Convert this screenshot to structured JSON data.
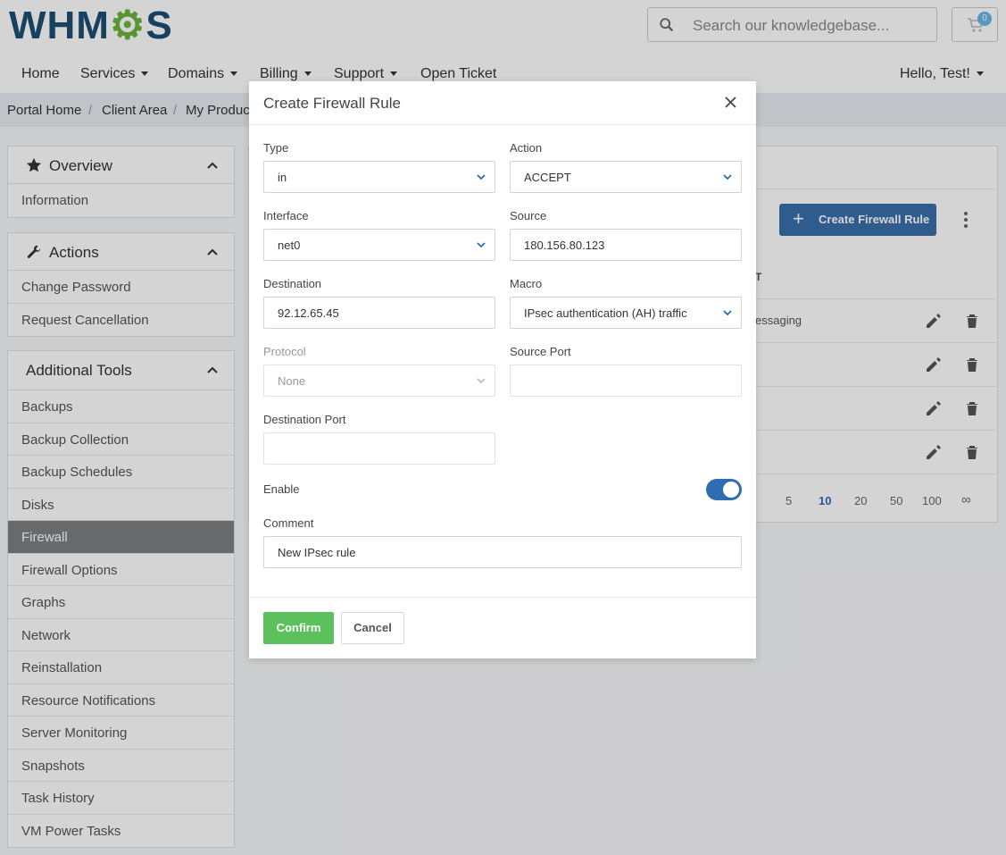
{
  "header": {
    "logo_text_a": "WHM",
    "logo_text_b": "C",
    "logo_text_c": "S",
    "search_placeholder": "Search our knowledgebase...",
    "cart_count": "0"
  },
  "nav": {
    "items": [
      {
        "label": "Home"
      },
      {
        "label": "Services"
      },
      {
        "label": "Domains"
      },
      {
        "label": "Billing"
      },
      {
        "label": "Support"
      },
      {
        "label": "Open Ticket"
      }
    ],
    "user_label": "Hello, Test!"
  },
  "breadcrumb": {
    "items": [
      {
        "label": "Portal Home"
      },
      {
        "label": "Client Area"
      },
      {
        "label": "My Produc"
      }
    ],
    "separator": "/"
  },
  "sidebar": {
    "overview": {
      "title": "Overview",
      "items": [
        {
          "label": "Information"
        }
      ]
    },
    "actions": {
      "title": "Actions",
      "items": [
        {
          "label": "Change Password"
        },
        {
          "label": "Request Cancellation"
        }
      ]
    },
    "tools": {
      "title": "Additional Tools",
      "active": "Firewall",
      "items": [
        {
          "label": "Backups"
        },
        {
          "label": "Backup Collection"
        },
        {
          "label": "Backup Schedules"
        },
        {
          "label": "Disks"
        },
        {
          "label": "Firewall"
        },
        {
          "label": "Firewall Options"
        },
        {
          "label": "Graphs"
        },
        {
          "label": "Network"
        },
        {
          "label": "Reinstallation"
        },
        {
          "label": "Resource Notifications"
        },
        {
          "label": "Server Monitoring"
        },
        {
          "label": "Snapshots"
        },
        {
          "label": "Task History"
        },
        {
          "label": "VM Power Tasks"
        }
      ]
    }
  },
  "content": {
    "create_button_label": "Create Firewall Rule",
    "column_fragment": "T",
    "row_fragment": "essaging",
    "pagination": [
      {
        "label": "5"
      },
      {
        "label": "10"
      },
      {
        "label": "20"
      },
      {
        "label": "50"
      },
      {
        "label": "100"
      },
      {
        "label": "∞"
      }
    ],
    "pagination_selected": "10"
  },
  "modal": {
    "title": "Create Firewall Rule",
    "fields": {
      "type": {
        "label": "Type",
        "value": "in"
      },
      "action": {
        "label": "Action",
        "value": "ACCEPT"
      },
      "interface": {
        "label": "Interface",
        "value": "net0"
      },
      "source": {
        "label": "Source",
        "value": "180.156.80.123"
      },
      "destination": {
        "label": "Destination",
        "value": "92.12.65.45"
      },
      "macro": {
        "label": "Macro",
        "value": "IPsec authentication (AH) traffic"
      },
      "protocol": {
        "label": "Protocol",
        "value": "None"
      },
      "source_port": {
        "label": "Source Port",
        "value": ""
      },
      "destination_port": {
        "label": "Destination Port",
        "value": ""
      },
      "enable": {
        "label": "Enable",
        "value": true
      },
      "comment": {
        "label": "Comment",
        "value": "New IPsec rule"
      }
    },
    "confirm_label": "Confirm",
    "cancel_label": "Cancel"
  },
  "colors": {
    "primary": "#2f6cb0",
    "confirm": "#5cc15d",
    "brand_dark": "#1d4e73",
    "brand_green": "#6bb43e"
  }
}
